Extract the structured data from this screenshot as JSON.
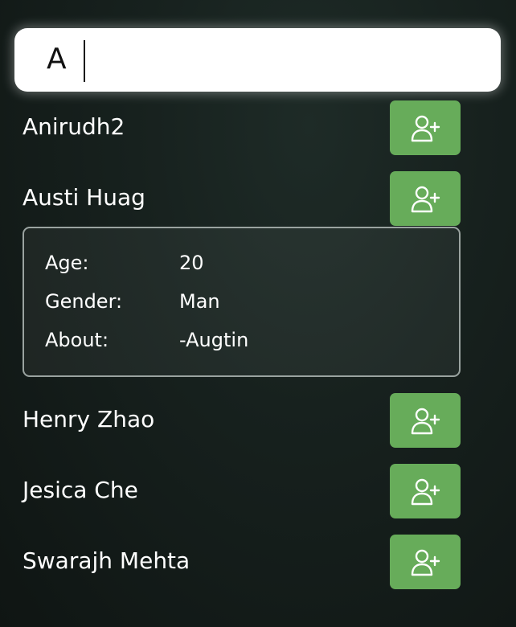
{
  "search": {
    "value": "A",
    "placeholder": ""
  },
  "users": [
    {
      "name": "Anirudh2",
      "add_icon": "add-user-icon"
    },
    {
      "name": "Austi Huag",
      "add_icon": "add-user-icon"
    },
    {
      "name": "Henry Zhao",
      "add_icon": "add-user-icon"
    },
    {
      "name": "Jesica Che",
      "add_icon": "add-user-icon"
    },
    {
      "name": "Swarajh Mehta",
      "add_icon": "add-user-icon"
    }
  ],
  "details": {
    "age_label": "Age:",
    "age_value": "20",
    "gender_label": "Gender:",
    "gender_value": "Man",
    "about_label": "About:",
    "about_value": "-Augtin"
  },
  "colors": {
    "add_button": "#67ac5a",
    "background": "#17211e"
  }
}
